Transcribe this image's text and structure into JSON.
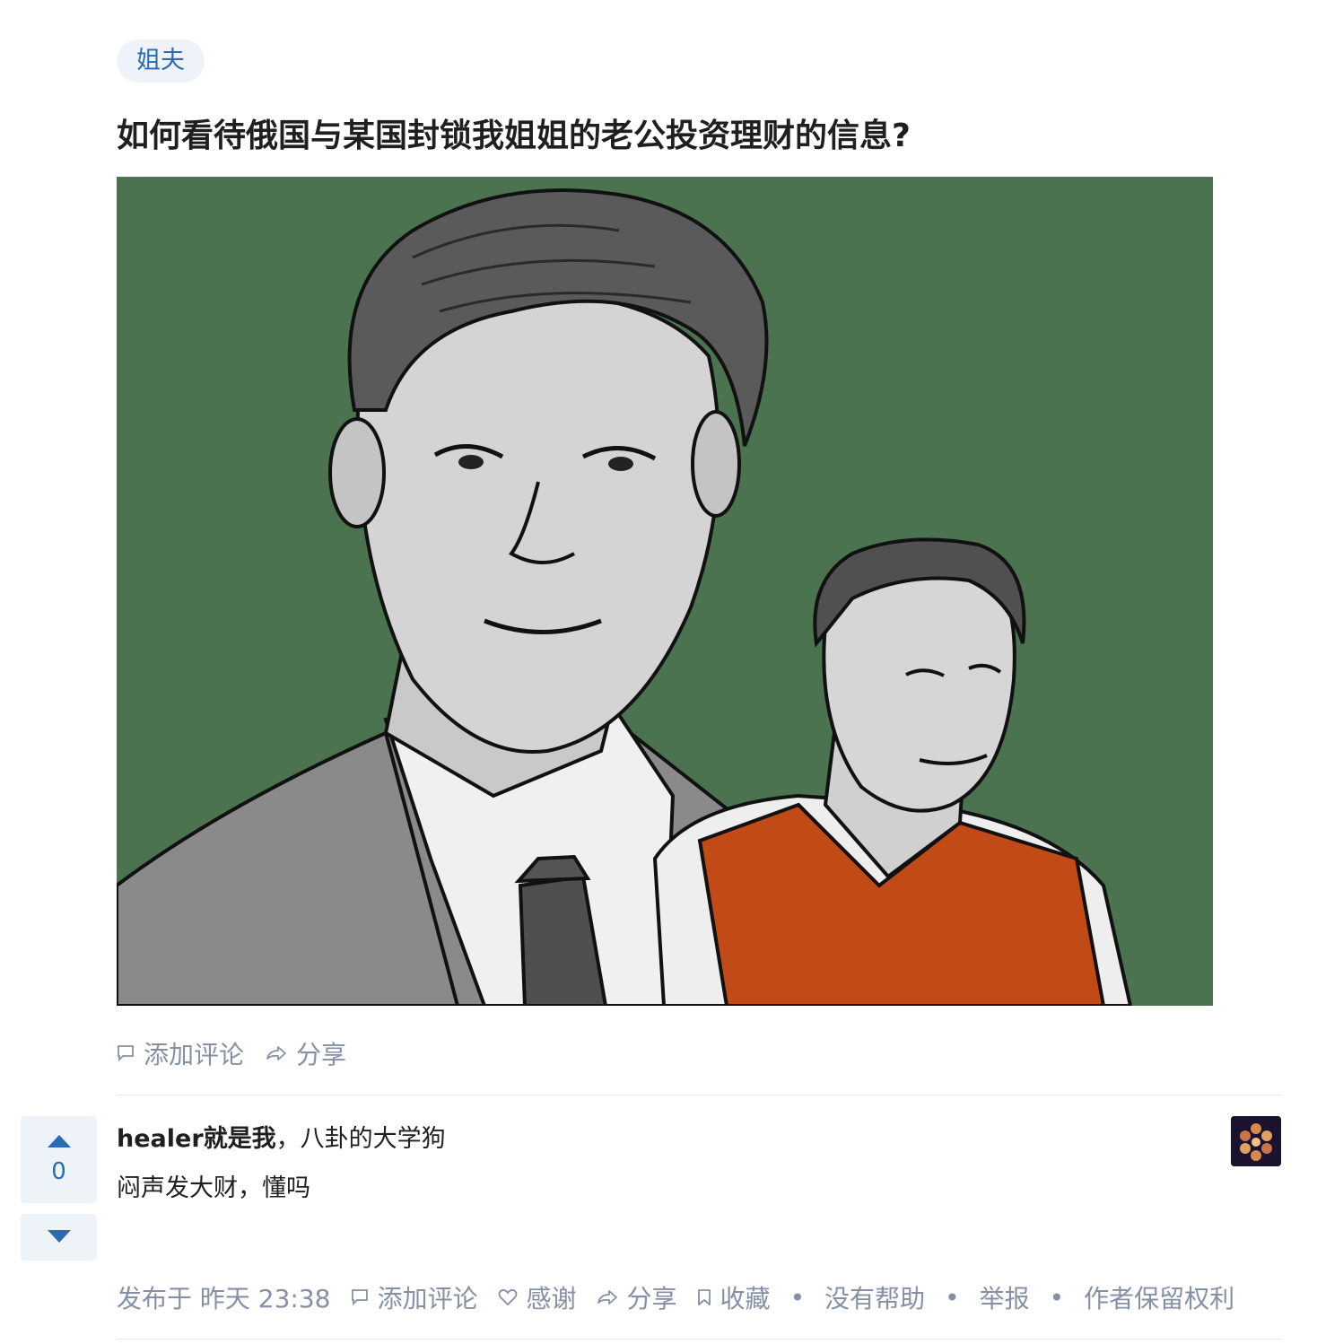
{
  "topic": {
    "tag": "姐夫"
  },
  "question": {
    "title": "如何看待俄国与某国封锁我姐姐的老公投资理财的信息?",
    "actions": {
      "comment": "添加评论",
      "share": "分享"
    }
  },
  "colors": {
    "link_blue": "#2a6bb3",
    "tag_bg": "#eef3fa",
    "meta_gray": "#8590a6",
    "illustration_bg": "#4b7350",
    "vest_orange": "#c24a16"
  },
  "answer": {
    "vote_count": "0",
    "author_name": "healer就是我",
    "author_bio": "，八卦的大学狗",
    "content": "闷声发大财，懂吗",
    "published": "发布于 昨天 23:38",
    "actions": {
      "comment": "添加评论",
      "thanks": "感谢",
      "share": "分享",
      "collect": "收藏",
      "no_help": "没有帮助",
      "report": "举报",
      "copyright": "作者保留权利"
    }
  },
  "icons": {
    "comment": "comment-icon",
    "share": "share-icon",
    "thanks": "heart-icon",
    "collect": "bookmark-icon",
    "vote_up": "triangle-up-icon",
    "vote_down": "triangle-down-icon"
  }
}
